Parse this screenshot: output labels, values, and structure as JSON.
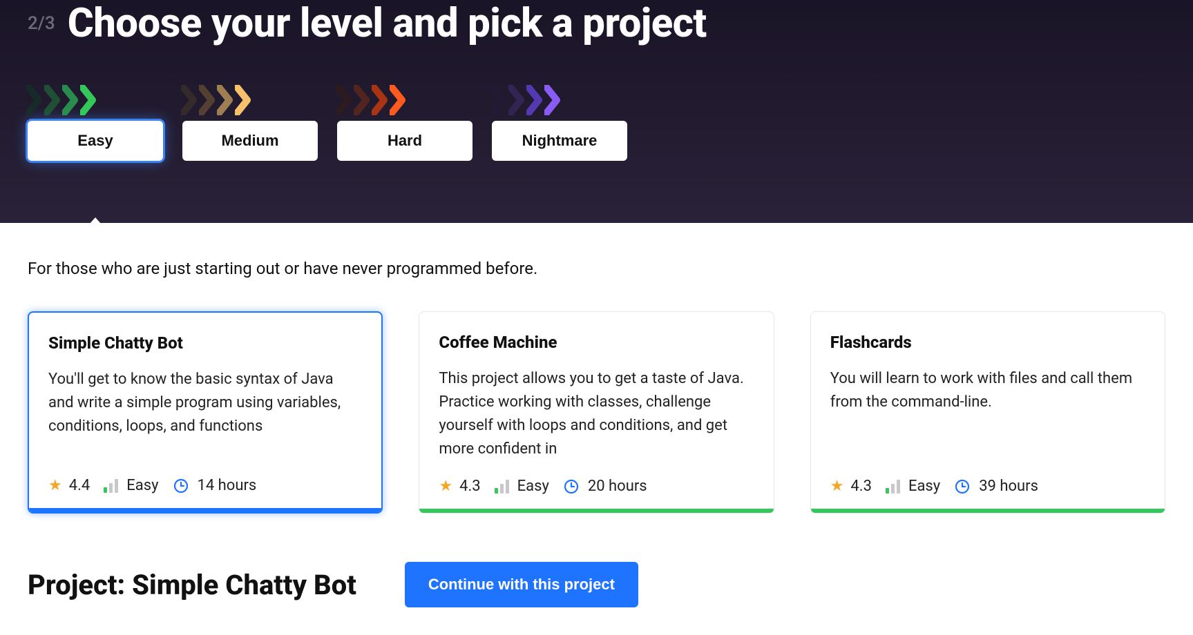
{
  "step": "2/3",
  "title": "Choose your level and pick a project",
  "levels": [
    {
      "label": "Easy",
      "selected": true,
      "colors": [
        "#0f3b22",
        "#1f6b3a",
        "#2aa452",
        "#34c759"
      ]
    },
    {
      "label": "Medium",
      "selected": false,
      "colors": [
        "#4a3b2a",
        "#6e5336",
        "#b8925a",
        "#f5c26b"
      ]
    },
    {
      "label": "Hard",
      "selected": false,
      "colors": [
        "#3a1b12",
        "#6a2a18",
        "#c23a10",
        "#ff5a1f"
      ]
    },
    {
      "label": "Nightmare",
      "selected": false,
      "colors": [
        "#241a3a",
        "#3b2a66",
        "#5e3fcc",
        "#8a5cf6"
      ]
    }
  ],
  "intro": "For those who are just starting out or have never programmed before.",
  "cards": [
    {
      "title": "Simple Chatty Bot",
      "desc": "You'll get to know the basic syntax of Java and write a simple program using variables, conditions, loops, and functions",
      "rating": "4.4",
      "level": "Easy",
      "hours": "14 hours",
      "selected": true
    },
    {
      "title": "Coffee Machine",
      "desc": "This project allows you to get a taste of Java. Practice working with classes, challenge yourself with loops and conditions, and get more confident in",
      "rating": "4.3",
      "level": "Easy",
      "hours": "20 hours",
      "selected": false
    },
    {
      "title": "Flashcards",
      "desc": "You will learn to work with files and call them from the command-line.",
      "rating": "4.3",
      "level": "Easy",
      "hours": "39 hours",
      "selected": false
    }
  ],
  "project": {
    "heading": "Project: Simple Chatty Bot",
    "cta": "Continue with this project"
  }
}
